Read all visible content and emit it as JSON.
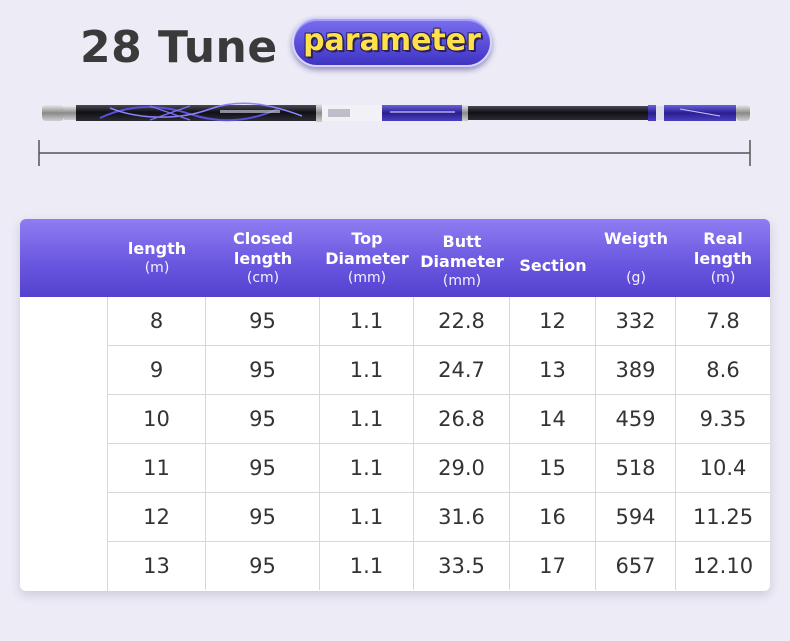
{
  "header": {
    "title": "28 Tune",
    "badge": "parameter"
  },
  "colors": {
    "header_gradient_top": "#8f7df2",
    "header_gradient_bottom": "#5441cf",
    "badge_text": "#ffe14a",
    "rod_accent": "#3b2fb0"
  },
  "table": {
    "columns": [
      {
        "label": "length",
        "unit": "(m)"
      },
      {
        "label": "Closed length",
        "unit": "(cm)"
      },
      {
        "label": "Top Diameter",
        "unit": "(mm)"
      },
      {
        "label": "Butt Diameter",
        "unit": "(mm)"
      },
      {
        "label": "Section",
        "unit": ""
      },
      {
        "label": "Weigth",
        "unit": "(g)"
      },
      {
        "label": "Real length",
        "unit": "(m)"
      }
    ],
    "rows": [
      [
        "8",
        "95",
        "1.1",
        "22.8",
        "12",
        "332",
        "7.8"
      ],
      [
        "9",
        "95",
        "1.1",
        "24.7",
        "13",
        "389",
        "8.6"
      ],
      [
        "10",
        "95",
        "1.1",
        "26.8",
        "14",
        "459",
        "9.35"
      ],
      [
        "11",
        "95",
        "1.1",
        "29.0",
        "15",
        "518",
        "10.4"
      ],
      [
        "12",
        "95",
        "1.1",
        "31.6",
        "16",
        "594",
        "11.25"
      ],
      [
        "13",
        "95",
        "1.1",
        "33.5",
        "17",
        "657",
        "12.10"
      ]
    ]
  }
}
